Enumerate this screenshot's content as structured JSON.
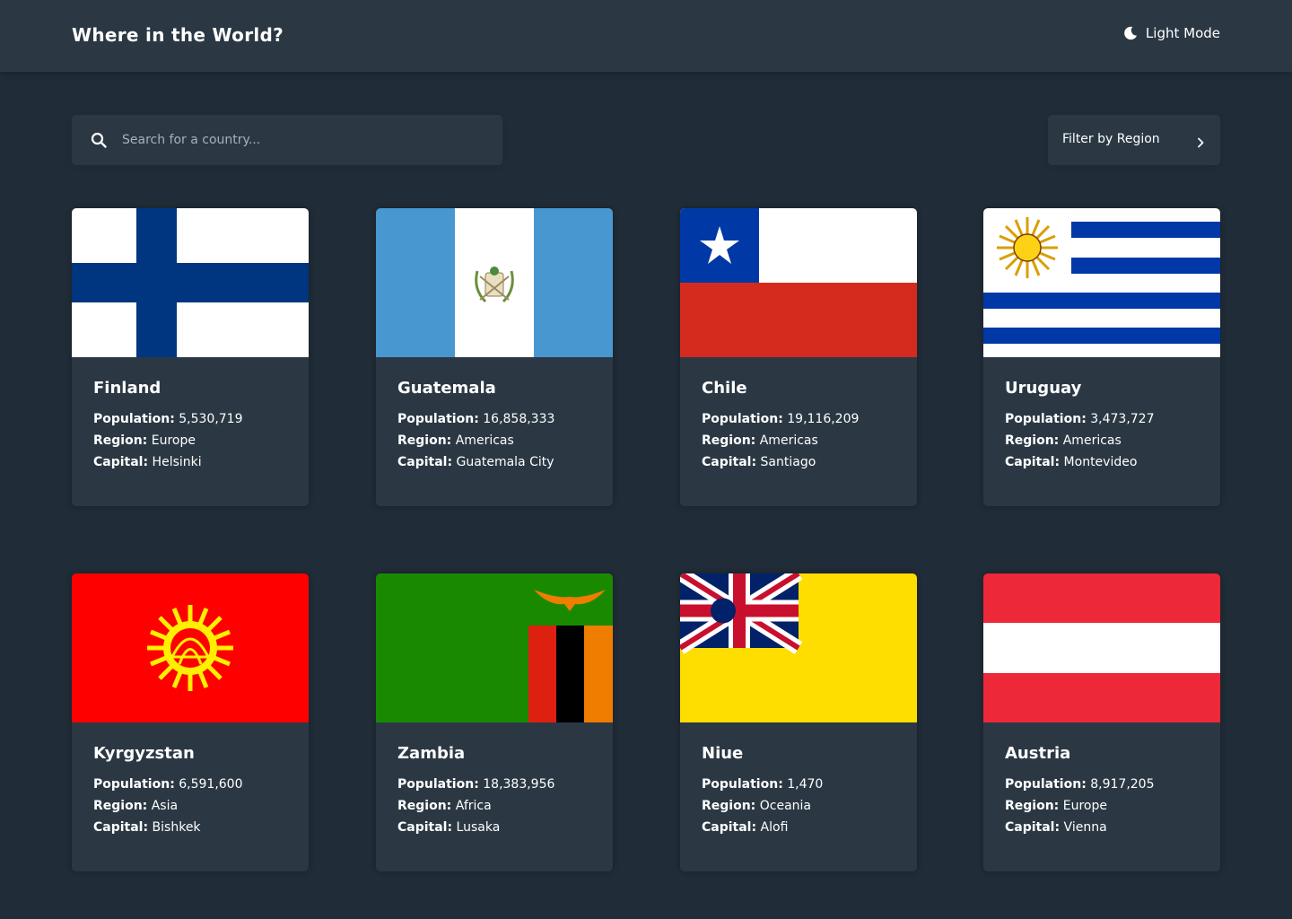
{
  "header": {
    "title": "Where in the World?",
    "mode_label": "Light Mode",
    "mode_icon": "moon-icon"
  },
  "search": {
    "placeholder": "Search for a country...",
    "value": "",
    "icon": "search-icon"
  },
  "filter": {
    "label": "Filter by Region",
    "icon": "chevron-right-icon"
  },
  "labels": {
    "population": "Population:",
    "region": "Region:",
    "capital": "Capital:"
  },
  "countries": [
    {
      "name": "Finland",
      "population": "5,530,719",
      "region": "Europe",
      "capital": "Helsinki"
    },
    {
      "name": "Guatemala",
      "population": "16,858,333",
      "region": "Americas",
      "capital": "Guatemala City"
    },
    {
      "name": "Chile",
      "population": "19,116,209",
      "region": "Americas",
      "capital": "Santiago"
    },
    {
      "name": "Uruguay",
      "population": "3,473,727",
      "region": "Americas",
      "capital": "Montevideo"
    },
    {
      "name": "Kyrgyzstan",
      "population": "6,591,600",
      "region": "Asia",
      "capital": "Bishkek"
    },
    {
      "name": "Zambia",
      "population": "18,383,956",
      "region": "Africa",
      "capital": "Lusaka"
    },
    {
      "name": "Niue",
      "population": "1,470",
      "region": "Oceania",
      "capital": "Alofi"
    },
    {
      "name": "Austria",
      "population": "8,917,205",
      "region": "Europe",
      "capital": "Vienna"
    }
  ],
  "colors": {
    "background": "#202c37",
    "element": "#2b3844",
    "text": "#ffffff",
    "placeholder": "#a8b0b8"
  }
}
